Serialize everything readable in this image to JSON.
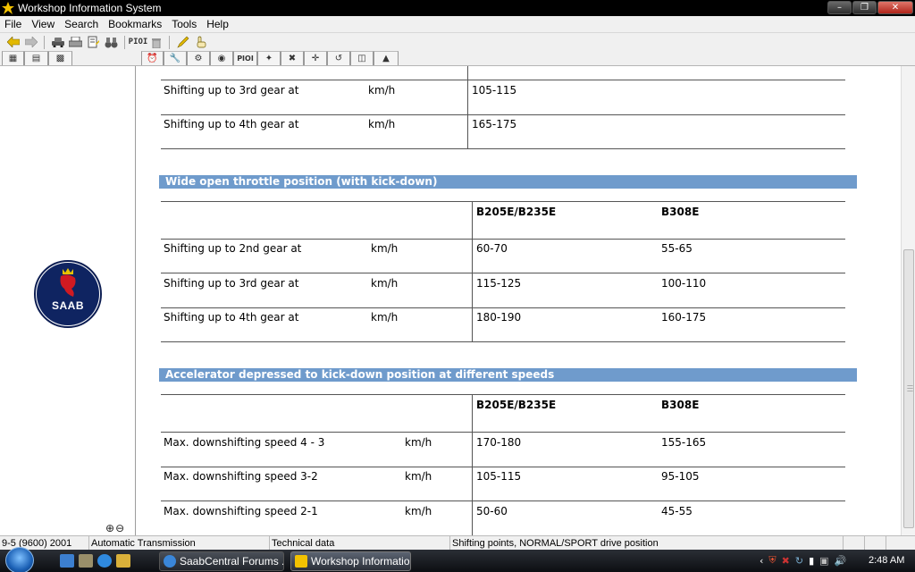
{
  "window": {
    "title": "Workshop Information System"
  },
  "menu": [
    "File",
    "View",
    "Search",
    "Bookmarks",
    "Tools",
    "Help"
  ],
  "toolbar": {
    "pio_label": "PIOI",
    "tab_pio_label": "PIOI"
  },
  "logo": {
    "text": "SAAB"
  },
  "table_top": {
    "rows": [
      {
        "label": "Shifting up to 3rd gear at",
        "unit": "km/h",
        "v1": "105-115"
      },
      {
        "label": "Shifting up to 4th gear at",
        "unit": "km/h",
        "v1": "165-175"
      }
    ]
  },
  "section_wot": {
    "heading": "Wide open throttle position (with kick-down)",
    "col1": "B205E/B235E",
    "col2": "B308E",
    "rows": [
      {
        "label": "Shifting up to 2nd gear at",
        "unit": "km/h",
        "v1": "60-70",
        "v2": "55-65"
      },
      {
        "label": "Shifting up to 3rd gear at",
        "unit": "km/h",
        "v1": "115-125",
        "v2": "100-110"
      },
      {
        "label": "Shifting up to 4th gear at",
        "unit": "km/h",
        "v1": "180-190",
        "v2": "160-175"
      }
    ]
  },
  "section_kd": {
    "heading": "Accelerator depressed to kick-down position at different speeds",
    "col1": "B205E/B235E",
    "col2": "B308E",
    "rows": [
      {
        "label": "Max. downshifting speed 4 - 3",
        "unit": "km/h",
        "v1": "170-180",
        "v2": "155-165"
      },
      {
        "label": "Max. downshifting speed 3-2",
        "unit": "km/h",
        "v1": "105-115",
        "v2": "95-105"
      },
      {
        "label": "Max. downshifting speed 2-1",
        "unit": "km/h",
        "v1": "50-60",
        "v2": "45-55"
      }
    ]
  },
  "status": {
    "model": "9-5 (9600) 2001",
    "group": "Automatic Transmission",
    "type": "Technical data",
    "topic": "Shifting points, NORMAL/SPORT drive position"
  },
  "taskbar": {
    "task1": "SaabCentral Forums ...",
    "task2": "Workshop Informatio...",
    "clock": "2:48 AM"
  }
}
